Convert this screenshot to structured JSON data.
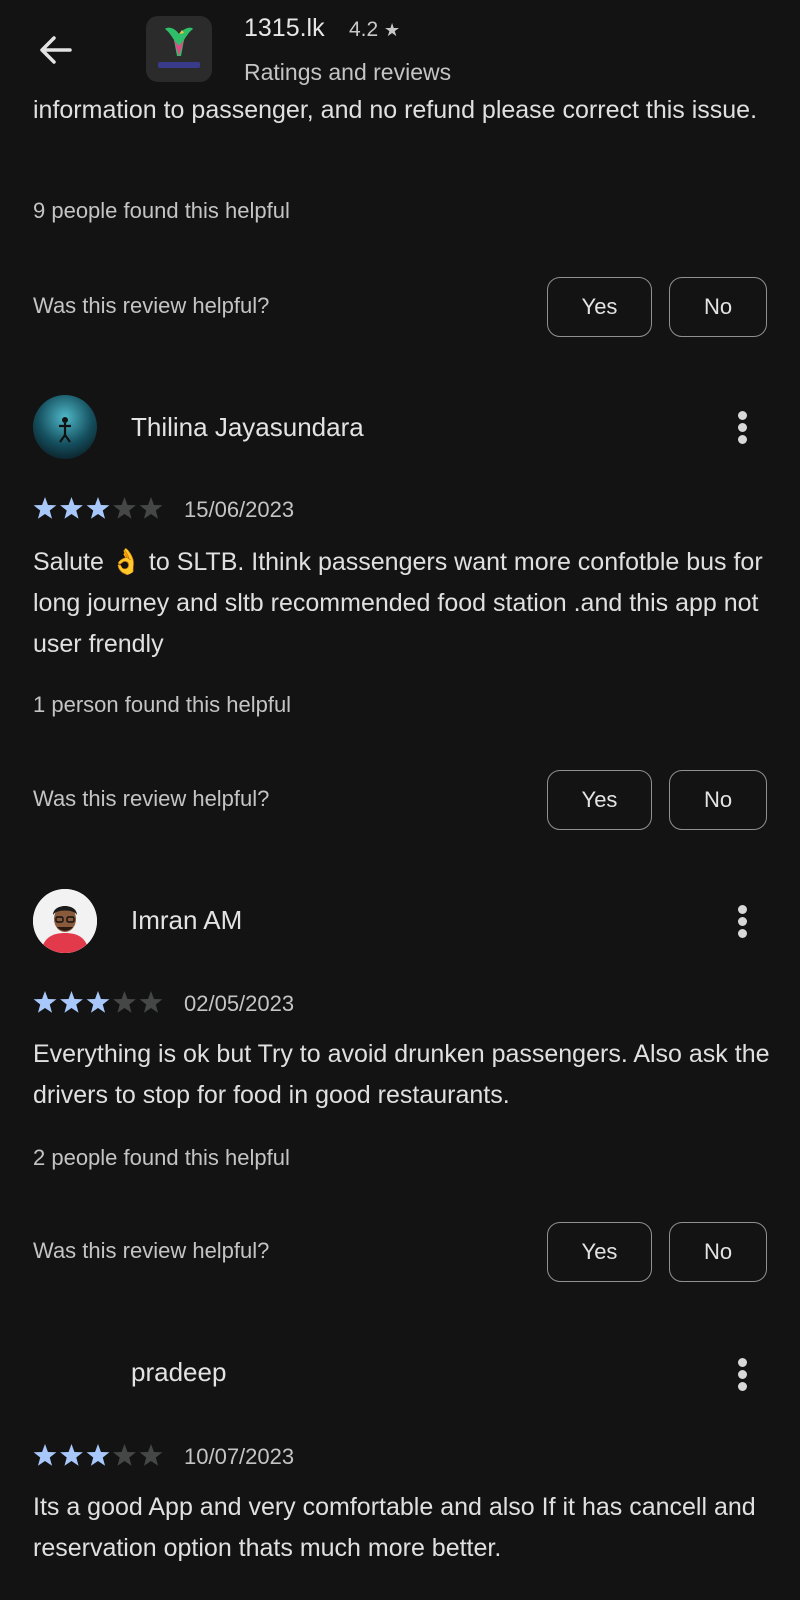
{
  "header": {
    "app_name": "1315.lk",
    "app_rating": "4.2",
    "subtitle": "Ratings and reviews",
    "back_icon": "arrow-left-icon",
    "star_icon": "star-icon"
  },
  "previous_review": {
    "text_partial": "information to passenger, and no refund please correct this issue.",
    "helpful_count": "9 people found this helpful",
    "helpful_question": "Was this review helpful?",
    "yes": "Yes",
    "no": "No"
  },
  "reviews": [
    {
      "name": "Thilina Jayasundara",
      "rating": 3,
      "date": "15/06/2023",
      "text": "Salute 👌 to SLTB. Ithink passengers want more confotble bus for long journey and sltb recommended food station .and this app not user frendly",
      "helpful_count": "1 person found this helpful",
      "helpful_question": "Was this review helpful?",
      "yes": "Yes",
      "no": "No"
    },
    {
      "name": "Imran AM",
      "rating": 3,
      "date": "02/05/2023",
      "text": "Everything is ok but Try to avoid drunken passengers. Also ask the drivers to stop for food in good restaurants.",
      "helpful_count": "2 people found this helpful",
      "helpful_question": "Was this review helpful?",
      "yes": "Yes",
      "no": "No"
    },
    {
      "name": "pradeep",
      "rating": 3,
      "date": "10/07/2023",
      "text": "Its a good App and very comfortable and also If it has cancell and reservation option thats much more better."
    }
  ],
  "colors": {
    "background": "#131313",
    "star_filled": "#a8c7fa",
    "star_empty": "#444746",
    "button_border": "#8e918f"
  }
}
